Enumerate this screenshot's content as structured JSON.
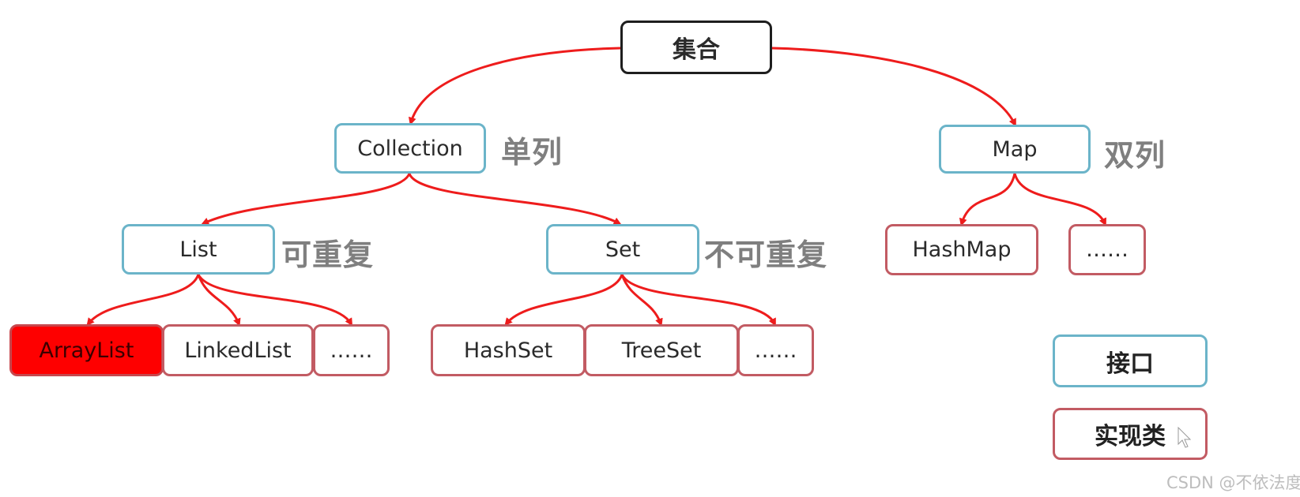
{
  "colors": {
    "arrow": "#ee1c1c",
    "interface_border": "#6bb4c9",
    "impl_border": "#c25b63",
    "root_border": "#1e1e1e",
    "highlight_fill": "#fe0000",
    "note_text": "#7f7f7f"
  },
  "root": {
    "label": "集合"
  },
  "level1": [
    {
      "id": "collection",
      "label": "Collection",
      "note": "单列",
      "kind": "interface"
    },
    {
      "id": "map",
      "label": "Map",
      "note": "双列",
      "kind": "interface"
    }
  ],
  "level2": [
    {
      "id": "list",
      "label": "List",
      "note": "可重复",
      "kind": "interface",
      "parent": "collection"
    },
    {
      "id": "set",
      "label": "Set",
      "note": "不可重复",
      "kind": "interface",
      "parent": "collection"
    },
    {
      "id": "hashmap",
      "label": "HashMap",
      "kind": "implementation",
      "parent": "map"
    },
    {
      "id": "map-more",
      "label": "……",
      "kind": "implementation",
      "parent": "map"
    }
  ],
  "level3": [
    {
      "id": "arraylist",
      "label": "ArrayList",
      "kind": "implementation",
      "parent": "list",
      "highlighted": true
    },
    {
      "id": "linkedlist",
      "label": "LinkedList",
      "kind": "implementation",
      "parent": "list"
    },
    {
      "id": "list-more",
      "label": "……",
      "kind": "implementation",
      "parent": "list"
    },
    {
      "id": "hashset",
      "label": "HashSet",
      "kind": "implementation",
      "parent": "set"
    },
    {
      "id": "treeset",
      "label": "TreeSet",
      "kind": "implementation",
      "parent": "set"
    },
    {
      "id": "set-more",
      "label": "……",
      "kind": "implementation",
      "parent": "set"
    }
  ],
  "legend": {
    "interface_label": "接口",
    "implementation_label": "实现类"
  },
  "watermark": "CSDN @不依法度"
}
